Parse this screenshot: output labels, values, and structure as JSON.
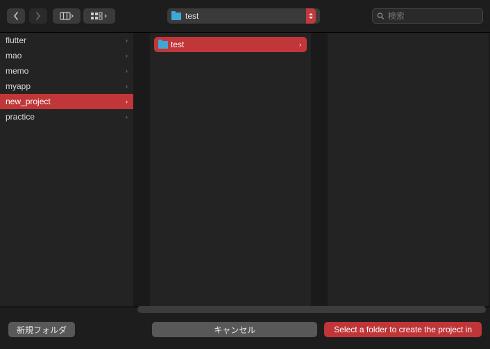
{
  "toolbar": {
    "path_label": "test",
    "search_placeholder": "検索"
  },
  "columns": [
    {
      "items": [
        {
          "label": "flutter",
          "selected": false,
          "has_children": true
        },
        {
          "label": "mao",
          "selected": false,
          "has_children": true
        },
        {
          "label": "memo",
          "selected": false,
          "has_children": true
        },
        {
          "label": "myapp",
          "selected": false,
          "has_children": true
        },
        {
          "label": "new_project",
          "selected": true,
          "has_children": true
        },
        {
          "label": "practice",
          "selected": false,
          "has_children": true
        }
      ]
    },
    {
      "items": [
        {
          "label": "test",
          "selected": true,
          "has_children": true,
          "icon": "folder"
        }
      ]
    },
    {
      "items": []
    }
  ],
  "footer": {
    "new_folder_label": "新規フォルダ",
    "cancel_label": "キャンセル",
    "confirm_label": "Select a folder to create the project in"
  },
  "colors": {
    "selection": "#c13638",
    "selection_alt": "#c03538",
    "bg": "#1d1d1d",
    "column_bg": "#232323",
    "button_bg": "#585858",
    "folder_icon": "#3fa7d6"
  }
}
